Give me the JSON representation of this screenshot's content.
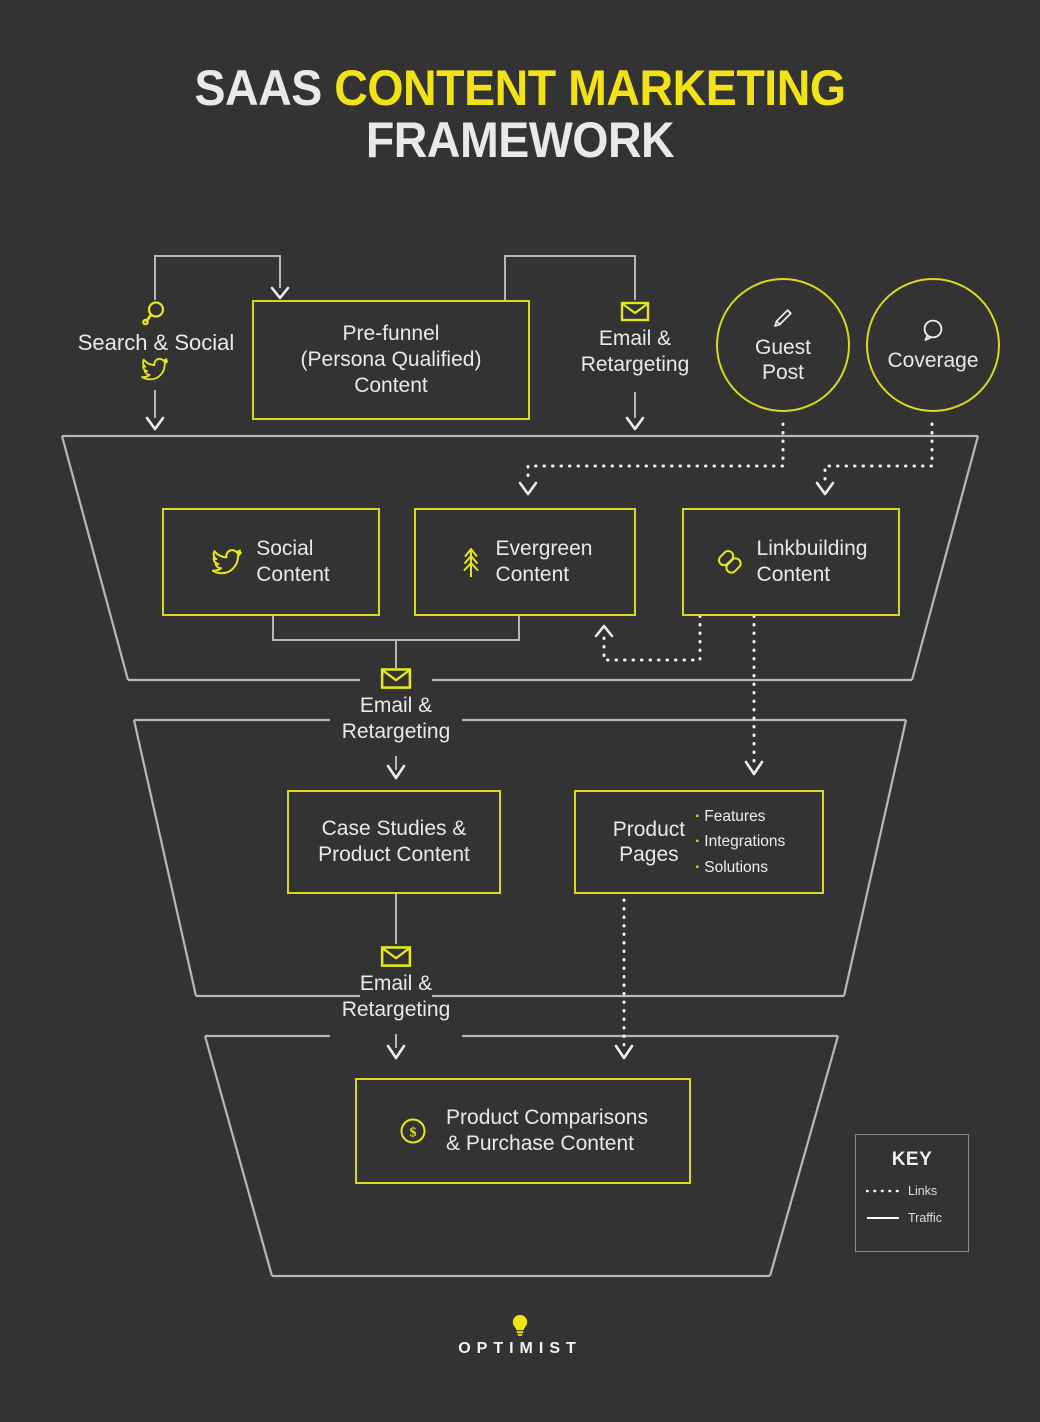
{
  "title": {
    "line1_white": "SAAS ",
    "line1_yellow": "CONTENT MARKETING",
    "line2": "FRAMEWORK"
  },
  "colors": {
    "background": "#333333",
    "accent_yellow": "#d8d822",
    "icon_yellow": "#e6e61e",
    "title_yellow": "#f2e319",
    "text_white": "#e9e9e9",
    "line_gray": "#b8b8b8"
  },
  "top_row": {
    "search_social": {
      "label": "Search & Social",
      "icons": [
        "search-icon",
        "twitter-icon"
      ]
    },
    "prefunnel": {
      "label": "Pre-funnel\n(Persona Qualified)\nContent",
      "line1": "Pre-funnel",
      "line2": "(Persona Qualified)",
      "line3": "Content"
    },
    "email_retargeting": {
      "line1": "Email &",
      "line2": "Retargeting",
      "icon": "envelope-icon"
    },
    "guest_post": {
      "line1": "Guest",
      "line2": "Post",
      "icon": "pencil-icon"
    },
    "coverage": {
      "line1": "Coverage",
      "icon": "speech-bubble-icon"
    }
  },
  "tier1": {
    "social_content": {
      "line1": "Social",
      "line2": "Content",
      "icon": "twitter-icon"
    },
    "evergreen_content": {
      "line1": "Evergreen",
      "line2": "Content",
      "icon": "evergreen-tree-icon"
    },
    "linkbuilding_content": {
      "line1": "Linkbuilding",
      "line2": "Content",
      "icon": "chain-link-icon"
    }
  },
  "divider1": {
    "line1": "Email &",
    "line2": "Retargeting",
    "icon": "envelope-icon"
  },
  "tier2": {
    "case_studies": {
      "line1": "Case Studies &",
      "line2": "Product Content"
    },
    "product_pages": {
      "title_line1": "Product",
      "title_line2": "Pages",
      "bullets": [
        "Features",
        "Integrations",
        "Solutions"
      ]
    }
  },
  "divider2": {
    "line1": "Email &",
    "line2": "Retargeting",
    "icon": "envelope-icon"
  },
  "tier3": {
    "product_comparisons": {
      "line1": "Product Comparisons",
      "line2": "& Purchase Content",
      "icon": "dollar-coin-icon"
    }
  },
  "key": {
    "title": "KEY",
    "items": [
      {
        "label": "Links",
        "style": "dotted"
      },
      {
        "label": "Traffic",
        "style": "solid"
      }
    ]
  },
  "logo": {
    "word": "OPTIMIST",
    "mark": "lightbulb-icon"
  }
}
